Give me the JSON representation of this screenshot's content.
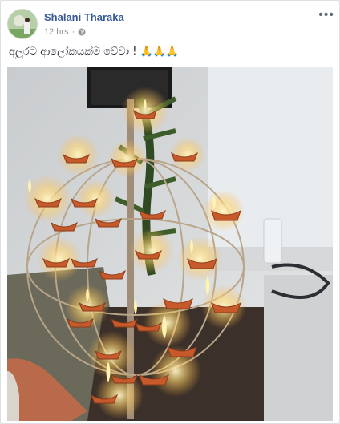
{
  "post": {
    "author": "Shalani Tharaka",
    "timestamp": "12 hrs",
    "separator": "·",
    "privacy_icon": "globe-icon",
    "more_icon": "ellipsis-icon",
    "caption_text": "අලුරට ආලෝකයක්ම වේවා !",
    "caption_emojis": "🙏🙏🙏",
    "photo_description_icon": "photo"
  },
  "colors": {
    "link": "#365899",
    "meta": "#90949c",
    "flame": "#ffd86b",
    "lamp": "#c65a2a"
  }
}
